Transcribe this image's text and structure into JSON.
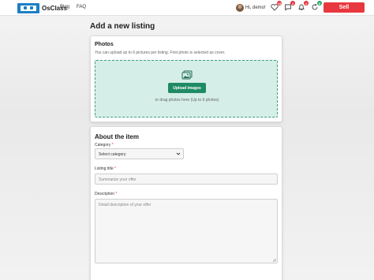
{
  "header": {
    "logo_text": "OsClass",
    "nav": [
      "Blog",
      "FAQ"
    ],
    "user_greeting": "Hi, demo!",
    "badges": {
      "heart": "15",
      "chat": "2",
      "bell": "2",
      "refresh": "8"
    },
    "sell_label": "Sell"
  },
  "page": {
    "title": "Add a new listing"
  },
  "photos": {
    "title": "Photos",
    "description": "You can upload up to 6 pictures per listing. First photo is selected as cover.",
    "upload_label": "Upload images",
    "drag_text": "or drag photos here (Up to 6 photos)"
  },
  "about": {
    "title": "About the item",
    "category_label": "Category",
    "category_value": "Select category",
    "listing_title_label": "Listing title",
    "listing_title_placeholder": "Summarize your offer",
    "description_label": "Description",
    "description_placeholder": "Detail description of your offer",
    "required_mark": "*"
  },
  "colors": {
    "accent": "#1f8a63",
    "sell": "#e8383f",
    "dropzone": "#d6eee8"
  }
}
